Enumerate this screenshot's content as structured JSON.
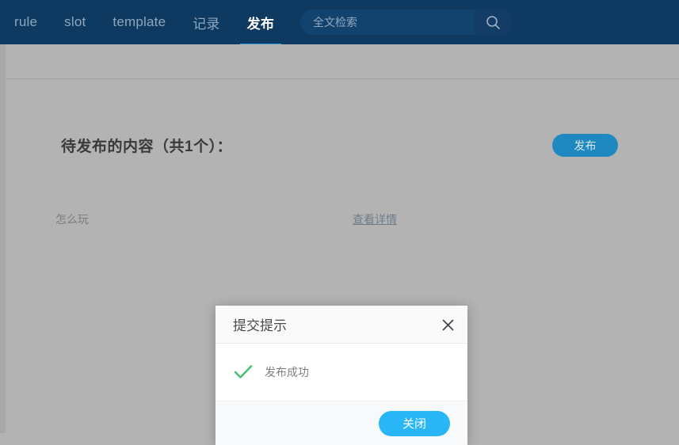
{
  "navbar": {
    "background_color": "#0e3a62",
    "active_underline_color": "#2e9fd4",
    "tabs": [
      {
        "label": "rule",
        "active": false
      },
      {
        "label": "slot",
        "active": false
      },
      {
        "label": "template",
        "active": false
      },
      {
        "label": "记录",
        "active": false
      },
      {
        "label": "发布",
        "active": true
      }
    ],
    "search": {
      "placeholder": "全文检索",
      "value": "",
      "icon": "search-icon"
    }
  },
  "content": {
    "page_title": "待发布的内容（共1个）：",
    "publish_button_label": "发布",
    "publish_button_color": "#2088c0",
    "items": [
      {
        "name": "怎么玩",
        "detail_link_label": "查看详情"
      }
    ]
  },
  "modal": {
    "title": "提交提示",
    "close_icon": "close-icon",
    "status_icon": "check-icon",
    "status_icon_color": "#4cc074",
    "message": "发布成功",
    "footer_button_label": "关闭",
    "footer_button_color": "#29b6f6"
  }
}
